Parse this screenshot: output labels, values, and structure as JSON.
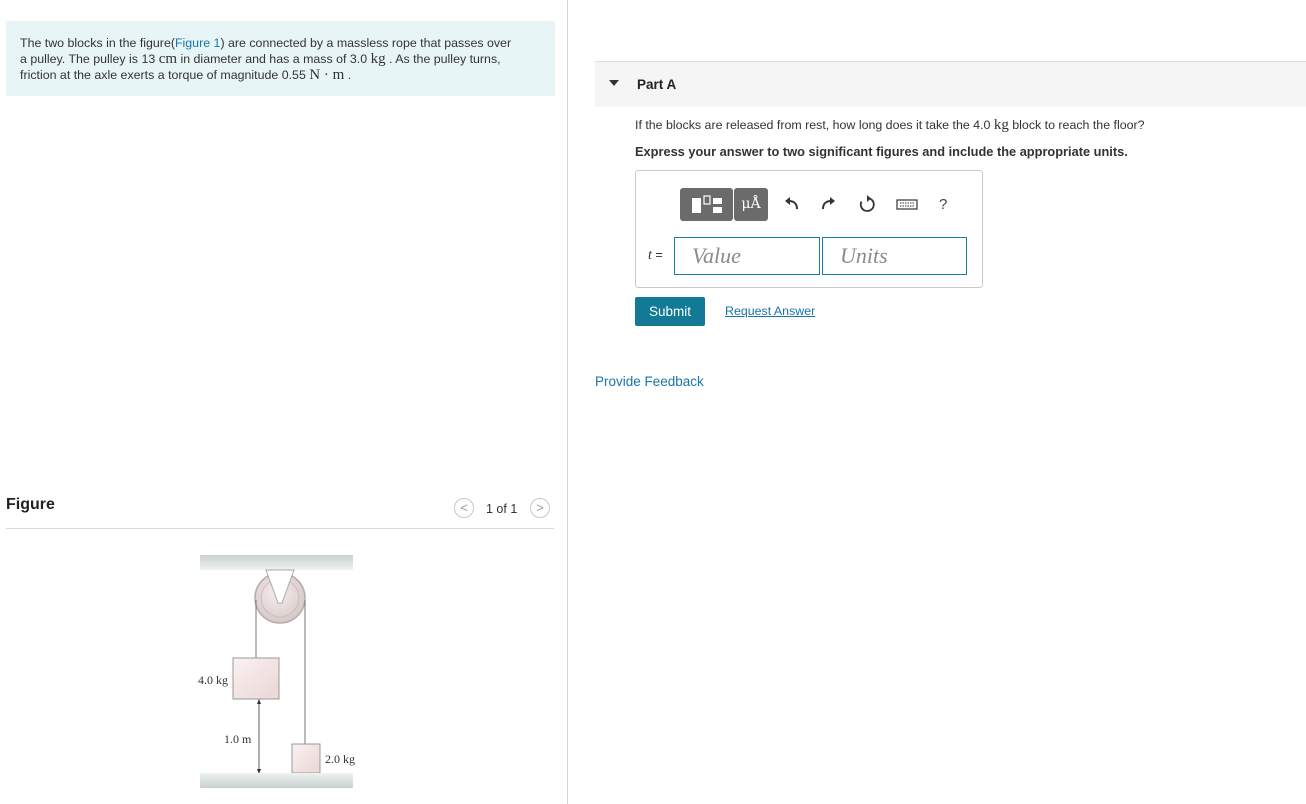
{
  "problem": {
    "text_before": "The two blocks in the figure(",
    "figure_link": "Figure 1",
    "text_line1_after": ") are connected by a massless rope that passes over",
    "text_line2_a": "a pulley. The pulley is 13 ",
    "unit_cm": "cm",
    "text_line2_b": " in diameter and has a mass of 3.0 ",
    "unit_kg": "kg",
    "text_line2_c": " . As the pulley turns,",
    "text_line3_a": "friction at the axle exerts a torque of magnitude 0.55 ",
    "unit_torque": "N · m",
    "text_line3_b": " ."
  },
  "figure_panel": {
    "title": "Figure",
    "pager_prev": "<",
    "pager_count": "1 of 1",
    "pager_next": ">",
    "labels": {
      "block_upper": "4.0 kg",
      "height": "1.0 m",
      "block_lower": "2.0 kg"
    }
  },
  "part_a": {
    "title": "Part A",
    "question_a": "If the blocks are released from rest, how long does it take the 4.0 ",
    "question_unit": "kg",
    "question_b": " block to reach the floor?",
    "instruction": "Express your answer to two significant figures and include the appropriate units.",
    "toolbar": {
      "units_button": "μÅ",
      "help": "?"
    },
    "variable": "t",
    "equals": " =",
    "value_placeholder": "Value",
    "units_placeholder": "Units",
    "submit": "Submit",
    "request_answer": "Request Answer"
  },
  "provide_feedback": "Provide Feedback",
  "colors": {
    "accent": "#127a96",
    "link": "#1a75a8",
    "problem_bg": "#e8f5f7"
  }
}
